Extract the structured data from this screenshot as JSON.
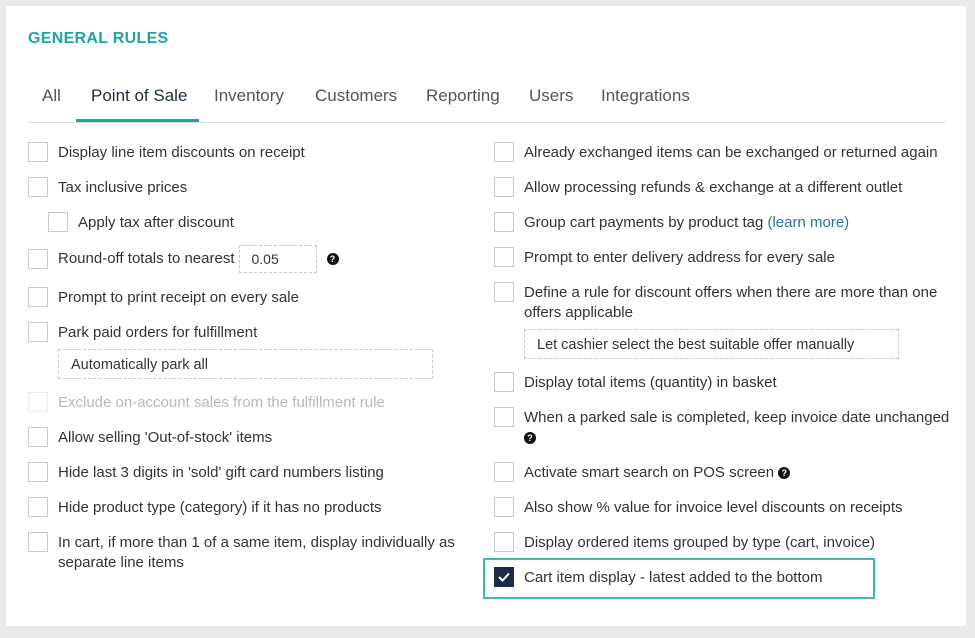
{
  "section_title": "GENERAL RULES",
  "tabs": [
    "All",
    "Point of Sale",
    "Inventory",
    "Customers",
    "Reporting",
    "Users",
    "Integrations"
  ],
  "active_tab": "Point of Sale",
  "left": {
    "display_discounts": "Display line item discounts on receipt",
    "tax_inclusive": "Tax inclusive prices",
    "apply_tax_after": "Apply tax after discount",
    "round_off": "Round-off totals to nearest",
    "round_off_value": "0.05",
    "prompt_print": "Prompt to print receipt on every sale",
    "park_paid": "Park paid orders for fulfillment",
    "park_option": "Automatically park all",
    "exclude_on_account": "Exclude on-account sales from the fulfillment rule",
    "allow_out_of_stock": "Allow selling 'Out-of-stock' items",
    "hide_digits": "Hide last 3 digits in 'sold' gift card numbers listing",
    "hide_product_type": "Hide product type (category) if it has no products",
    "in_cart_line1": "In cart, if more than 1 of a same item, display individually as",
    "in_cart_line2": "separate line items"
  },
  "right": {
    "already_exchanged": "Already exchanged items can be exchanged or returned again",
    "allow_refunds": "Allow processing refunds & exchange at a different outlet",
    "group_cart": "Group cart payments by product tag",
    "learn_more": "(learn more)",
    "prompt_delivery": "Prompt to enter delivery address for every sale",
    "define_rule_line1": "Define a rule for discount offers when there are more than one",
    "define_rule_line2": "offers applicable",
    "offer_option": "Let cashier select the best suitable offer manually",
    "display_total": "Display total items (quantity) in basket",
    "parked_sale": "When a parked sale is completed, keep invoice date unchanged",
    "smart_search": "Activate smart search on POS screen",
    "show_percent": "Also show % value for invoice level discounts on receipts",
    "display_ordered": "Display ordered items grouped by type (cart, invoice)",
    "cart_item_display": "Cart item display - latest added to the bottom"
  },
  "help_glyph": "?",
  "colors": {
    "accent": "#1fa4a4",
    "checked": "#1d2b4a",
    "highlight": "#3dbab0",
    "link": "#2a6fb0"
  }
}
